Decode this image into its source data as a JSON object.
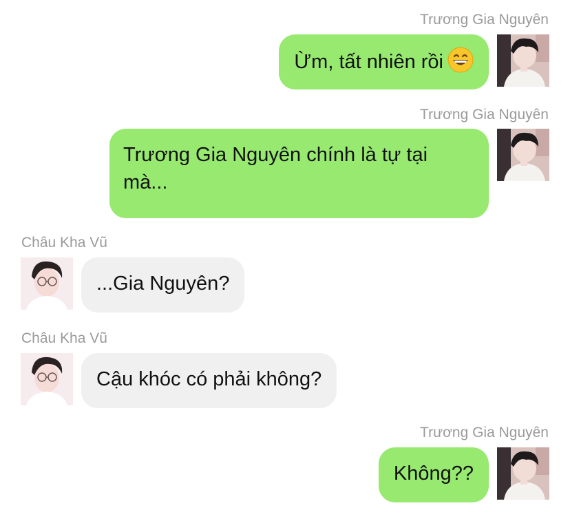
{
  "messages": [
    {
      "sender": "Trương Gia Nguyên",
      "side": "out",
      "text": "Ừm, tất nhiên rồi",
      "emoji": "grinning-face-emoji"
    },
    {
      "sender": "Trương Gia Nguyên",
      "side": "out",
      "text": "Trương Gia Nguyên chính là tự tại mà..."
    },
    {
      "sender": "Châu Kha Vũ",
      "side": "in",
      "text": "...Gia Nguyên?"
    },
    {
      "sender": "Châu Kha Vũ",
      "side": "in",
      "text": "Cậu khóc có phải không?"
    },
    {
      "sender": "Trương Gia Nguyên",
      "side": "out",
      "text": "Không??"
    }
  ],
  "colors": {
    "outgoing_bubble": "#97e970",
    "incoming_bubble": "#f0f0f0",
    "sender_name": "#9a9a9a",
    "text": "#111111"
  }
}
